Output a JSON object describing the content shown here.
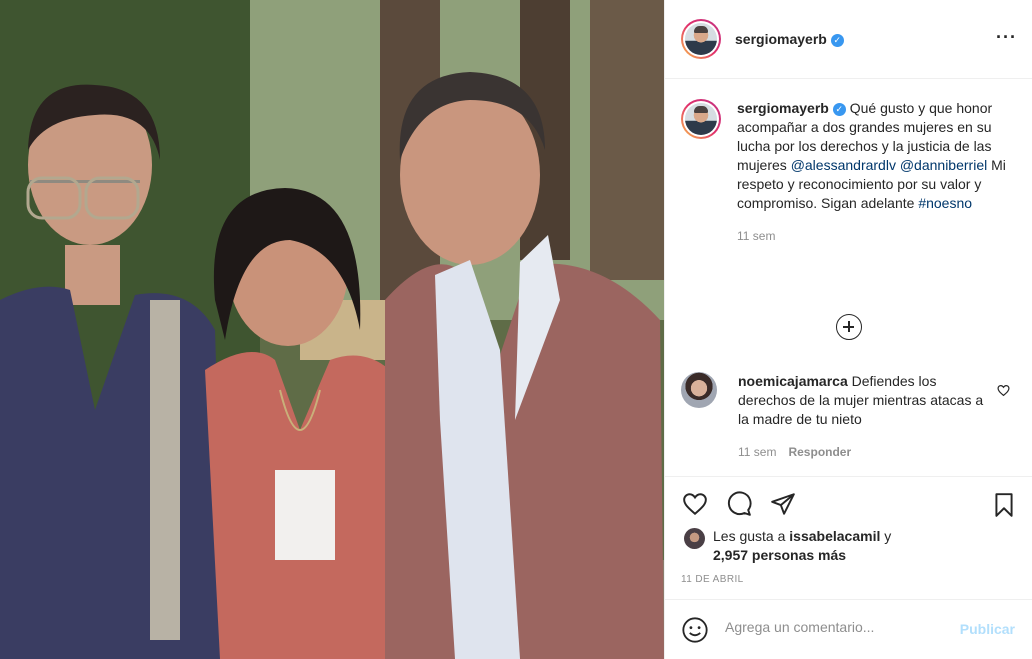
{
  "post": {
    "username": "sergiomayerb",
    "verified_badge": "✓",
    "more_icon": "more-horizontal-icon"
  },
  "caption": {
    "username": "sergiomayerb",
    "text_1": "Qué gusto y que honor acompañar a dos grandes mujeres en su lucha por los derechos y la justicia de las mujeres",
    "mention_1": "@alessandrardlv",
    "mention_2": "@danniberriel",
    "text_2": "Mi respeto y reconocimiento por su valor y compromiso. Sigan adelante",
    "hashtag": "#noesno",
    "time": "11 sem"
  },
  "comments": [
    {
      "username": "noemicajamarca",
      "text": "Defiendes los derechos de la mujer mientras atacas a la madre de tu nieto",
      "time": "11 sem",
      "reply_label": "Responder"
    }
  ],
  "likes": {
    "prefix": "Les gusta a",
    "user": "issabelacamil",
    "conj": "y",
    "others": "2,957 personas más"
  },
  "date": "11 DE ABRIL",
  "add_comment": {
    "placeholder": "Agrega un comentario...",
    "publish_label": "Publicar"
  },
  "colors": {
    "link": "#00376b",
    "verified": "#3897f0",
    "publish_disabled": "#b2dffc",
    "muted": "#8e8e8e"
  }
}
